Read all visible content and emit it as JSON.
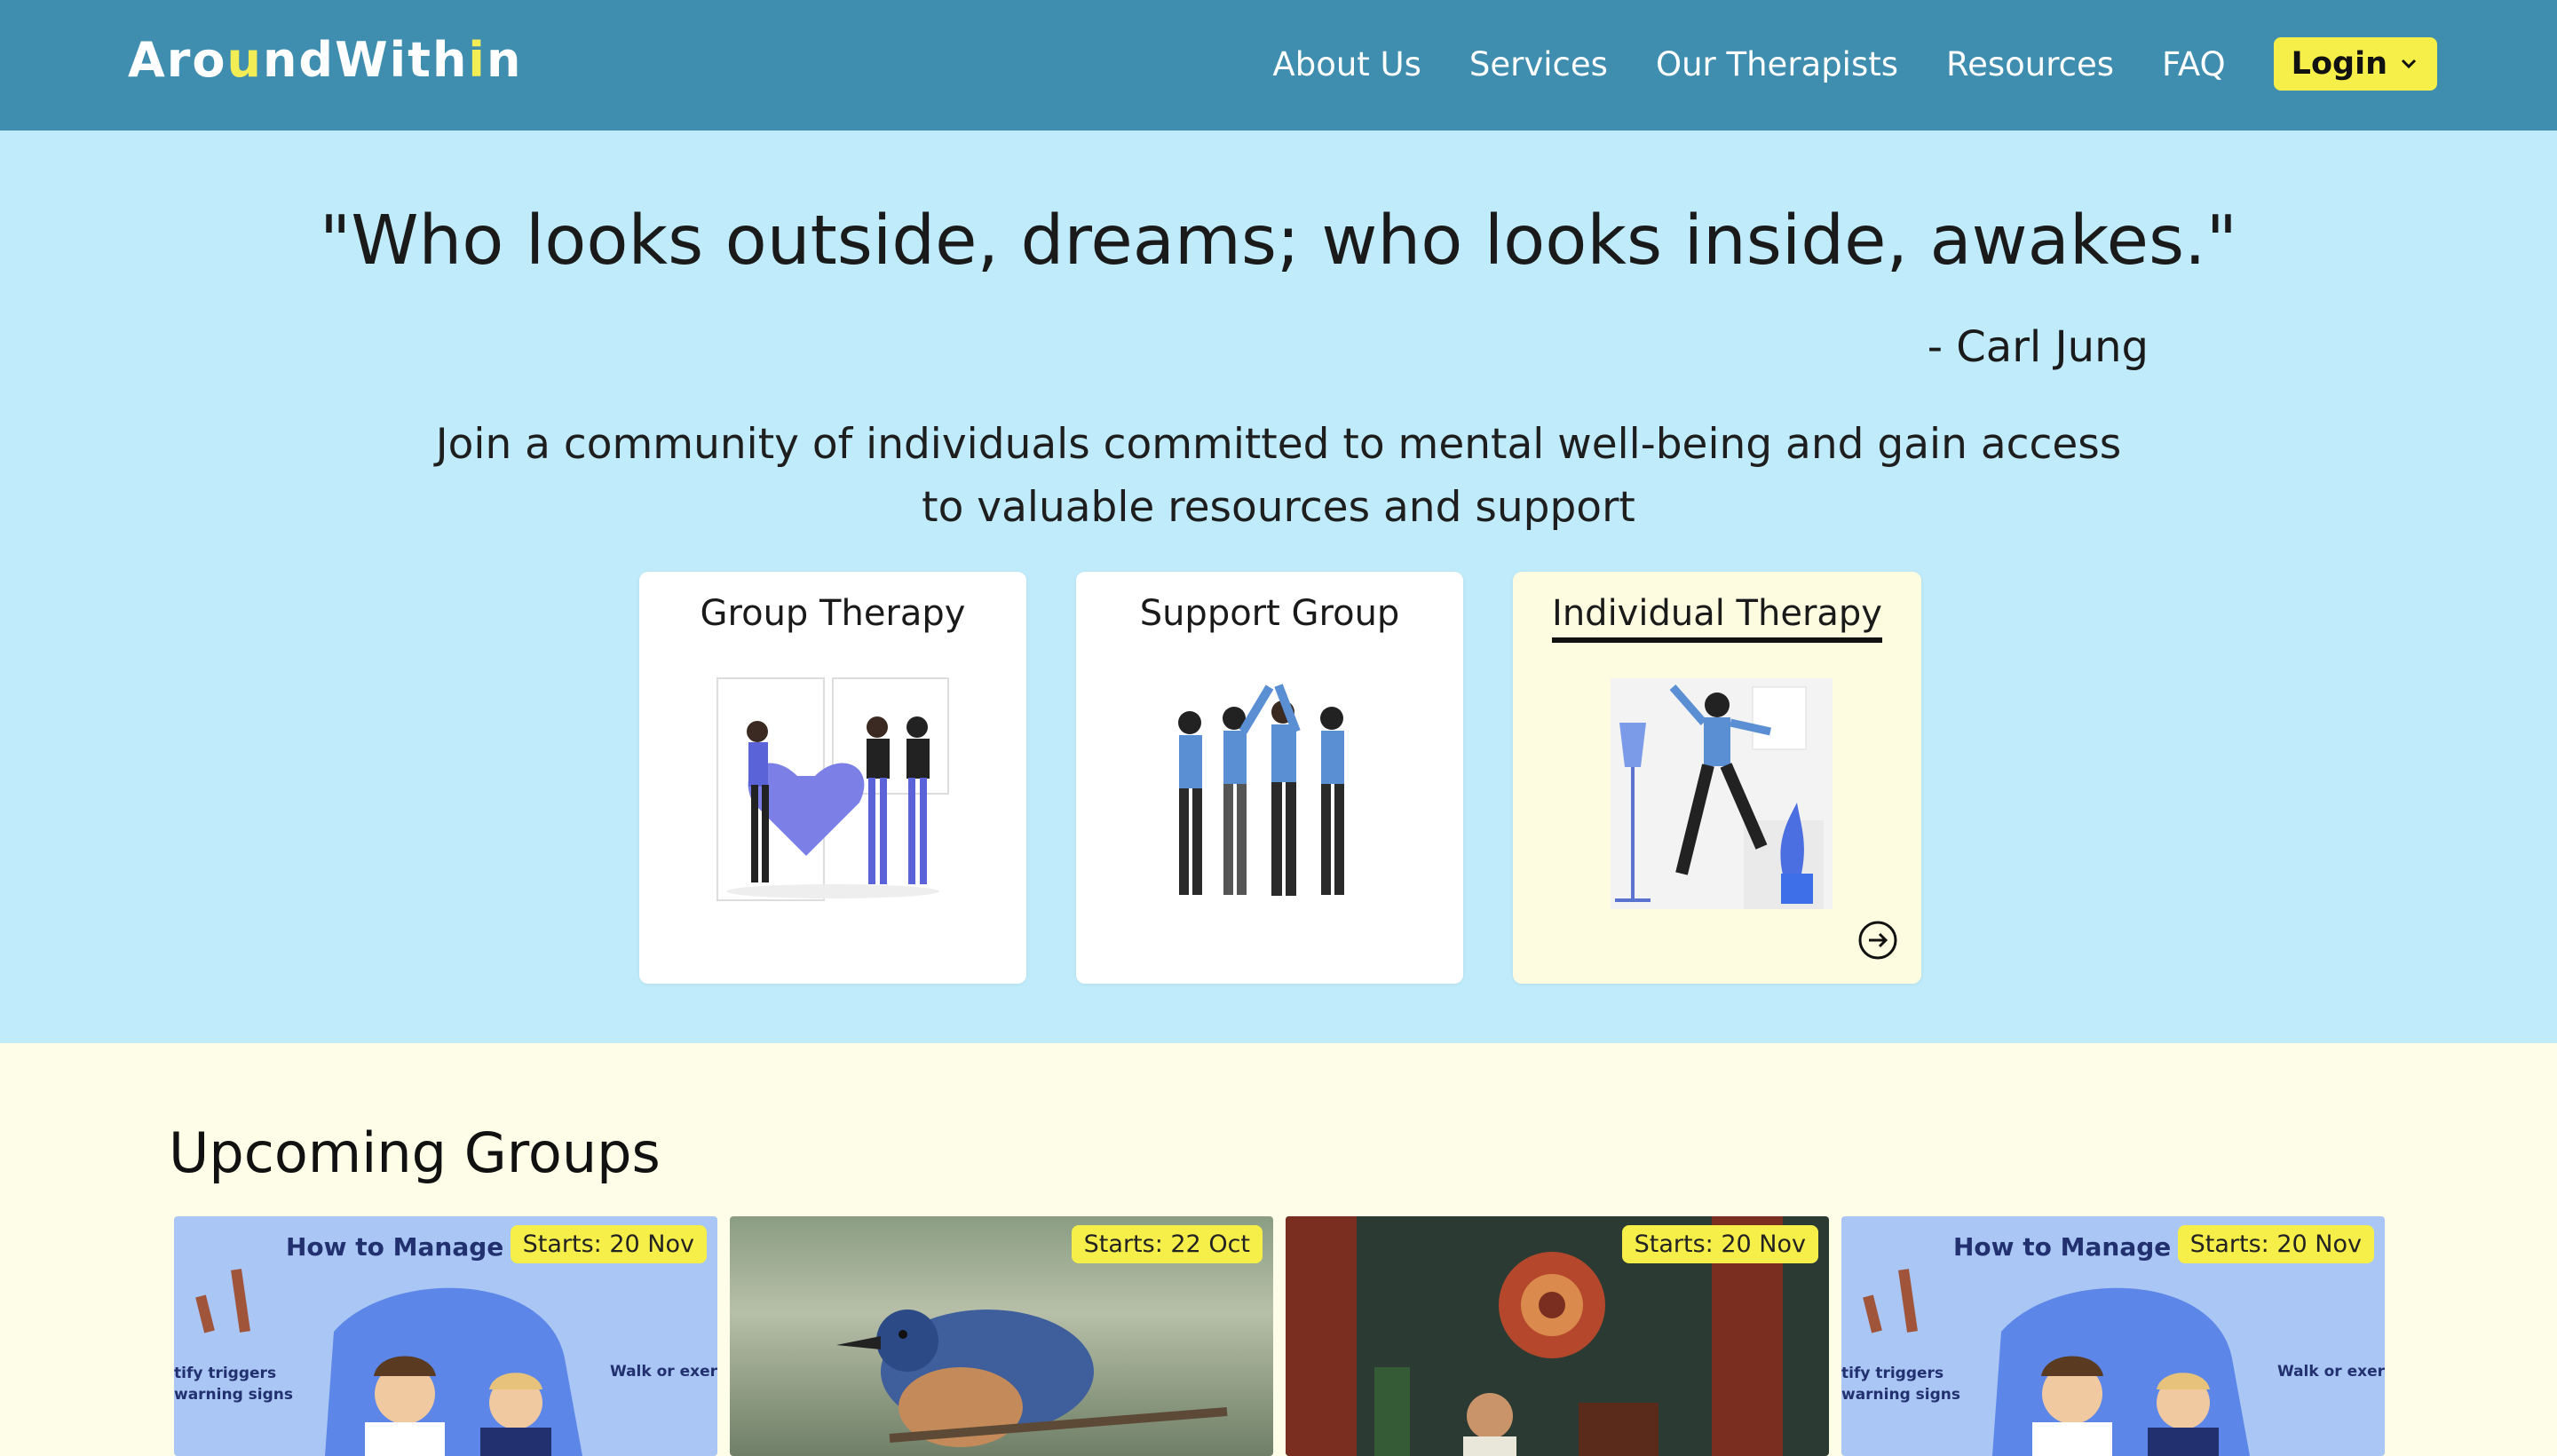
{
  "nav": {
    "logo_a": "Aro",
    "logo_u": "u",
    "logo_b": "ndWith",
    "logo_i": "i",
    "logo_c": "n",
    "links": [
      "About Us",
      "Services",
      "Our Therapists",
      "Resources",
      "FAQ"
    ],
    "login_label": "Login"
  },
  "hero": {
    "quote": "\"Who looks outside, dreams; who looks inside, awakes.\"",
    "author": "- Carl Jung",
    "tagline": "Join a community of individuals committed to mental well-being and gain access to valuable resources and support",
    "cards": [
      {
        "title": "Group Therapy"
      },
      {
        "title": "Support Group"
      },
      {
        "title": "Individual Therapy"
      }
    ]
  },
  "groups": {
    "heading": "Upcoming Groups",
    "items": [
      {
        "badge": "Starts: 20 Nov",
        "caption": "How to Manage Your",
        "note_left": "tify triggers\nwarning signs",
        "note_right": "Walk or exer"
      },
      {
        "badge": "Starts: 22 Oct"
      },
      {
        "badge": "Starts: 20 Nov"
      },
      {
        "badge": "Starts: 20 Nov",
        "caption": "How to Manage Your",
        "note_left": "tify triggers\nwarning signs",
        "note_right": "Walk or exer"
      }
    ]
  },
  "colors": {
    "navbar": "#3f8eb0",
    "hero_bg": "#bfebfa",
    "accent_yellow": "#f6ef4a",
    "page_bg": "#fefee8"
  }
}
